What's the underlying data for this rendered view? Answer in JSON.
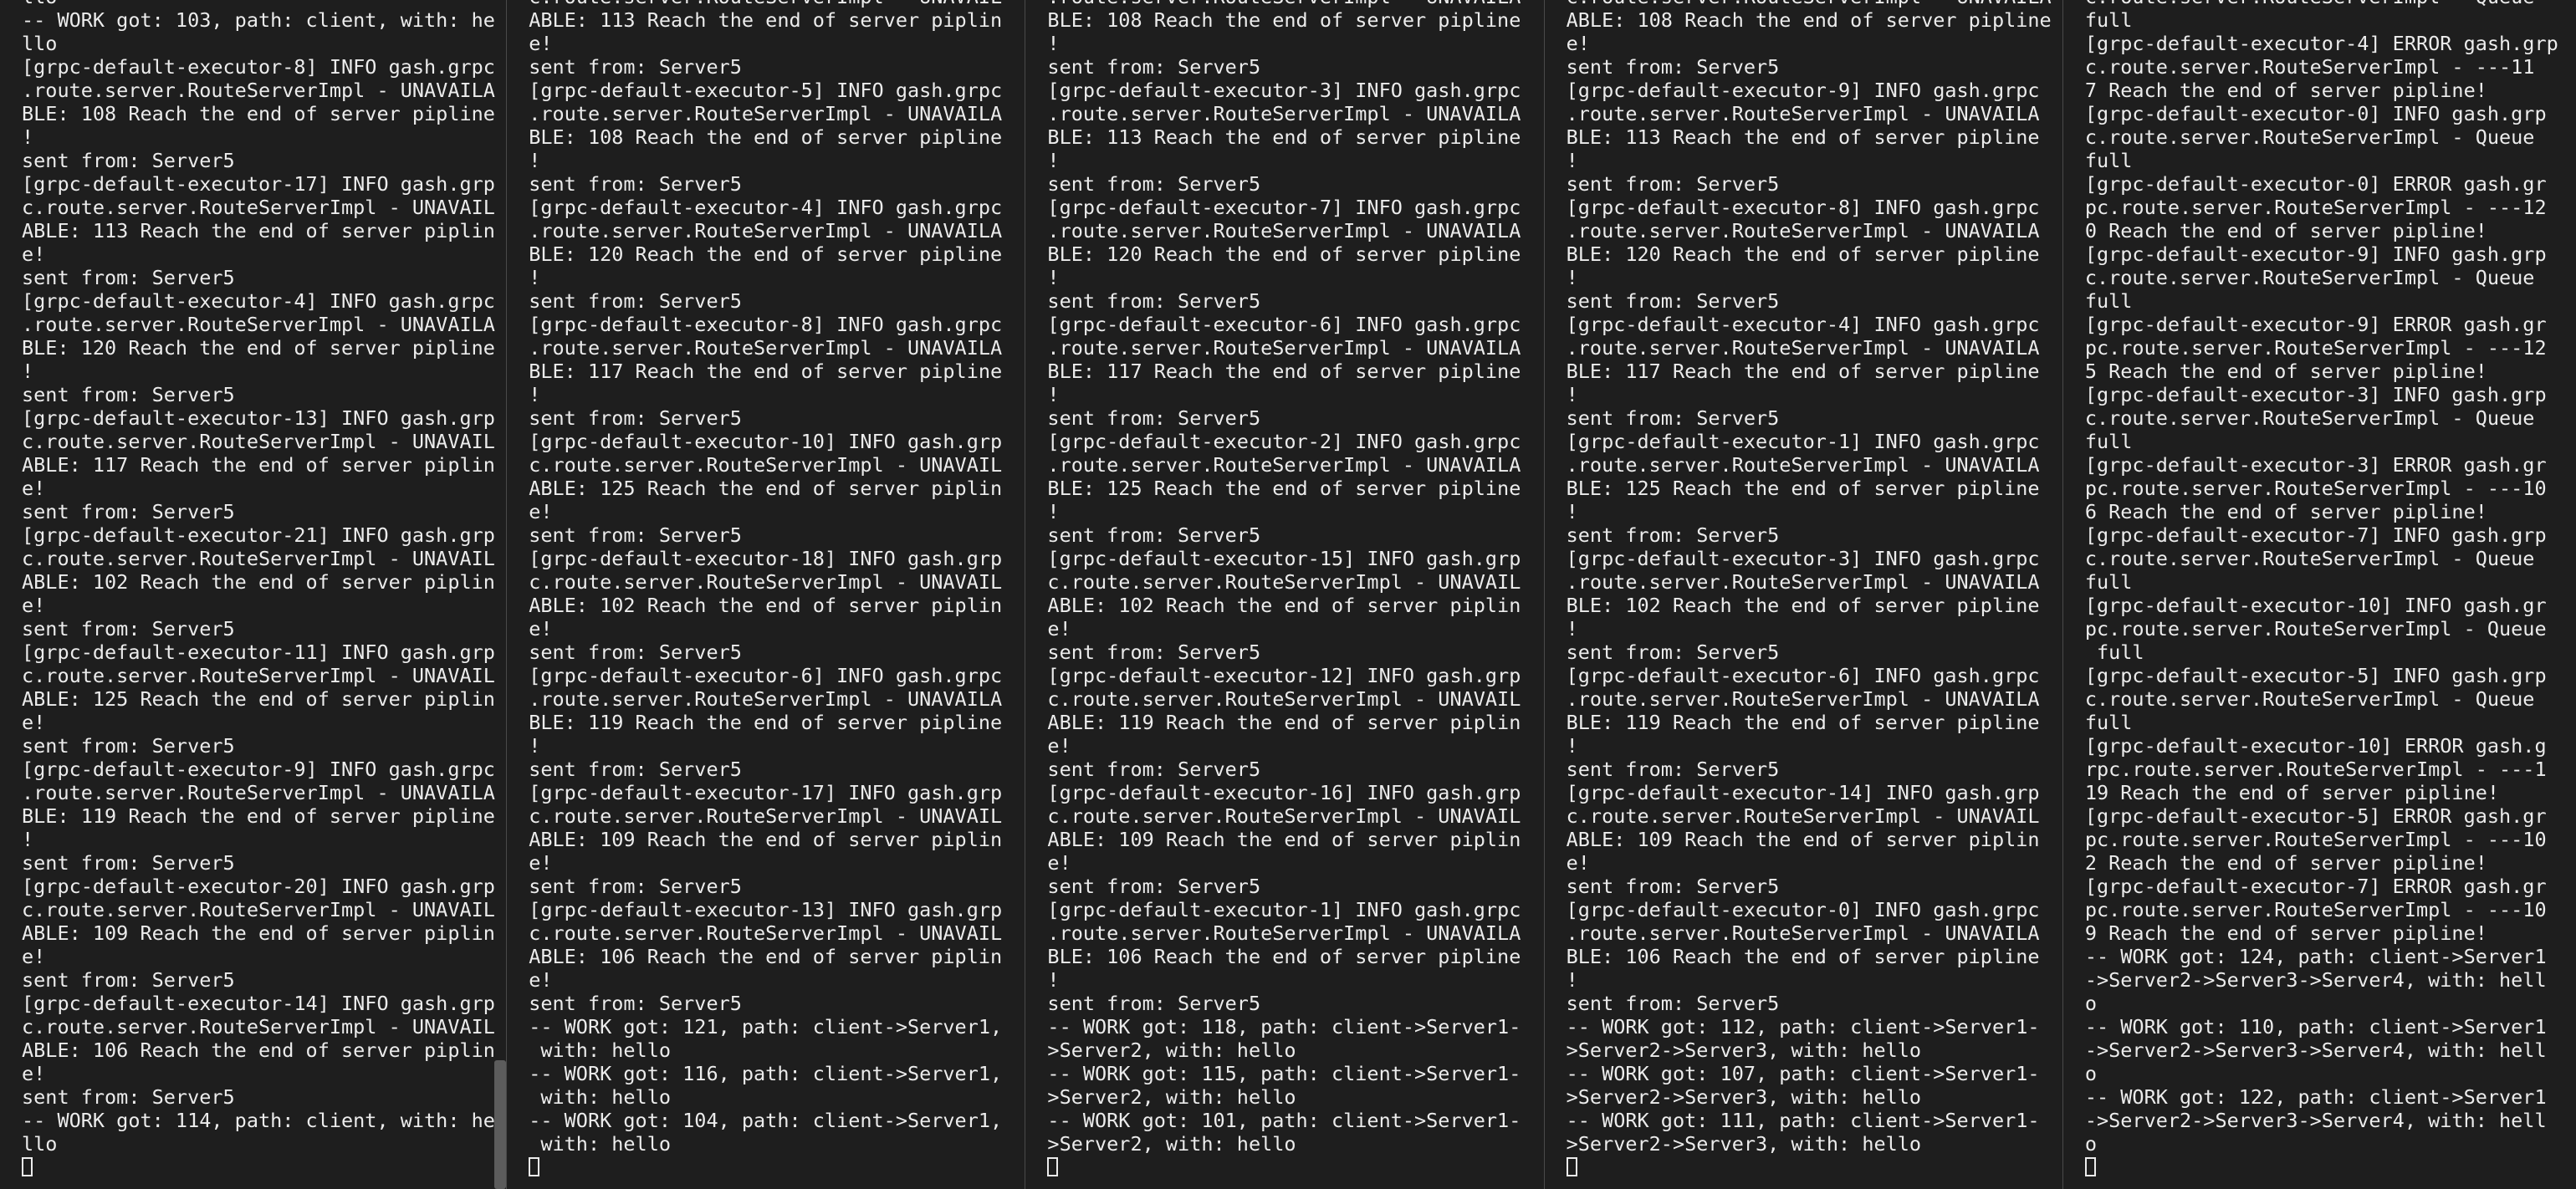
{
  "panes": [
    {
      "lines": [
        "llo",
        "-- WORK got: 103, path: client, with: he",
        "llo",
        "[grpc-default-executor-8] INFO gash.grpc",
        ".route.server.RouteServerImpl - UNAVAILA",
        "BLE: 108 Reach the end of server pipline",
        "!",
        "sent from: Server5",
        "[grpc-default-executor-17] INFO gash.grp",
        "c.route.server.RouteServerImpl - UNAVAIL",
        "ABLE: 113 Reach the end of server piplin",
        "e!",
        "sent from: Server5",
        "[grpc-default-executor-4] INFO gash.grpc",
        ".route.server.RouteServerImpl - UNAVAILA",
        "BLE: 120 Reach the end of server pipline",
        "!",
        "sent from: Server5",
        "[grpc-default-executor-13] INFO gash.grp",
        "c.route.server.RouteServerImpl - UNAVAIL",
        "ABLE: 117 Reach the end of server piplin",
        "e!",
        "sent from: Server5",
        "[grpc-default-executor-21] INFO gash.grp",
        "c.route.server.RouteServerImpl - UNAVAIL",
        "ABLE: 102 Reach the end of server piplin",
        "e!",
        "sent from: Server5",
        "[grpc-default-executor-11] INFO gash.grp",
        "c.route.server.RouteServerImpl - UNAVAIL",
        "ABLE: 125 Reach the end of server piplin",
        "e!",
        "sent from: Server5",
        "[grpc-default-executor-9] INFO gash.grpc",
        ".route.server.RouteServerImpl - UNAVAILA",
        "BLE: 119 Reach the end of server pipline",
        "!",
        "sent from: Server5",
        "[grpc-default-executor-20] INFO gash.grp",
        "c.route.server.RouteServerImpl - UNAVAIL",
        "ABLE: 109 Reach the end of server piplin",
        "e!",
        "sent from: Server5",
        "[grpc-default-executor-14] INFO gash.grp",
        "c.route.server.RouteServerImpl - UNAVAIL",
        "ABLE: 106 Reach the end of server piplin",
        "e!",
        "sent from: Server5",
        "-- WORK got: 114, path: client, with: he",
        "llo"
      ]
    },
    {
      "lines": [
        "c.route.server.RouteServerImpl - UNAVAIL",
        "ABLE: 113 Reach the end of server piplin",
        "e!",
        "sent from: Server5",
        "[grpc-default-executor-5] INFO gash.grpc",
        ".route.server.RouteServerImpl - UNAVAILA",
        "BLE: 108 Reach the end of server pipline",
        "!",
        "sent from: Server5",
        "[grpc-default-executor-4] INFO gash.grpc",
        ".route.server.RouteServerImpl - UNAVAILA",
        "BLE: 120 Reach the end of server pipline",
        "!",
        "sent from: Server5",
        "[grpc-default-executor-8] INFO gash.grpc",
        ".route.server.RouteServerImpl - UNAVAILA",
        "BLE: 117 Reach the end of server pipline",
        "!",
        "sent from: Server5",
        "[grpc-default-executor-10] INFO gash.grp",
        "c.route.server.RouteServerImpl - UNAVAIL",
        "ABLE: 125 Reach the end of server piplin",
        "e!",
        "sent from: Server5",
        "[grpc-default-executor-18] INFO gash.grp",
        "c.route.server.RouteServerImpl - UNAVAIL",
        "ABLE: 102 Reach the end of server piplin",
        "e!",
        "sent from: Server5",
        "[grpc-default-executor-6] INFO gash.grpc",
        ".route.server.RouteServerImpl - UNAVAILA",
        "BLE: 119 Reach the end of server pipline",
        "!",
        "sent from: Server5",
        "[grpc-default-executor-17] INFO gash.grp",
        "c.route.server.RouteServerImpl - UNAVAIL",
        "ABLE: 109 Reach the end of server piplin",
        "e!",
        "sent from: Server5",
        "[grpc-default-executor-13] INFO gash.grp",
        "c.route.server.RouteServerImpl - UNAVAIL",
        "ABLE: 106 Reach the end of server piplin",
        "e!",
        "sent from: Server5",
        "-- WORK got: 121, path: client->Server1,",
        " with: hello",
        "-- WORK got: 116, path: client->Server1,",
        " with: hello",
        "-- WORK got: 104, path: client->Server1,",
        " with: hello"
      ]
    },
    {
      "lines": [
        ".route.server.RouteServerImpl - UNAVAILA",
        "BLE: 108 Reach the end of server pipline",
        "!",
        "sent from: Server5",
        "[grpc-default-executor-3] INFO gash.grpc",
        ".route.server.RouteServerImpl - UNAVAILA",
        "BLE: 113 Reach the end of server pipline",
        "!",
        "sent from: Server5",
        "[grpc-default-executor-7] INFO gash.grpc",
        ".route.server.RouteServerImpl - UNAVAILA",
        "BLE: 120 Reach the end of server pipline",
        "!",
        "sent from: Server5",
        "[grpc-default-executor-6] INFO gash.grpc",
        ".route.server.RouteServerImpl - UNAVAILA",
        "BLE: 117 Reach the end of server pipline",
        "!",
        "sent from: Server5",
        "[grpc-default-executor-2] INFO gash.grpc",
        ".route.server.RouteServerImpl - UNAVAILA",
        "BLE: 125 Reach the end of server pipline",
        "!",
        "sent from: Server5",
        "[grpc-default-executor-15] INFO gash.grp",
        "c.route.server.RouteServerImpl - UNAVAIL",
        "ABLE: 102 Reach the end of server piplin",
        "e!",
        "sent from: Server5",
        "[grpc-default-executor-12] INFO gash.grp",
        "c.route.server.RouteServerImpl - UNAVAIL",
        "ABLE: 119 Reach the end of server piplin",
        "e!",
        "sent from: Server5",
        "[grpc-default-executor-16] INFO gash.grp",
        "c.route.server.RouteServerImpl - UNAVAIL",
        "ABLE: 109 Reach the end of server piplin",
        "e!",
        "sent from: Server5",
        "[grpc-default-executor-1] INFO gash.grpc",
        ".route.server.RouteServerImpl - UNAVAILA",
        "BLE: 106 Reach the end of server pipline",
        "!",
        "sent from: Server5",
        "-- WORK got: 118, path: client->Server1-",
        ">Server2, with: hello",
        "-- WORK got: 115, path: client->Server1-",
        ">Server2, with: hello",
        "-- WORK got: 101, path: client->Server1-",
        ">Server2, with: hello"
      ]
    },
    {
      "lines": [
        "c.route.server.RouteServerImpl - UNAVAILA",
        "ABLE: 108 Reach the end of server pipline",
        "e!",
        "sent from: Server5",
        "[grpc-default-executor-9] INFO gash.grpc",
        ".route.server.RouteServerImpl - UNAVAILA",
        "BLE: 113 Reach the end of server pipline",
        "!",
        "sent from: Server5",
        "[grpc-default-executor-8] INFO gash.grpc",
        ".route.server.RouteServerImpl - UNAVAILA",
        "BLE: 120 Reach the end of server pipline",
        "!",
        "sent from: Server5",
        "[grpc-default-executor-4] INFO gash.grpc",
        ".route.server.RouteServerImpl - UNAVAILA",
        "BLE: 117 Reach the end of server pipline",
        "!",
        "sent from: Server5",
        "[grpc-default-executor-1] INFO gash.grpc",
        ".route.server.RouteServerImpl - UNAVAILA",
        "BLE: 125 Reach the end of server pipline",
        "!",
        "sent from: Server5",
        "[grpc-default-executor-3] INFO gash.grpc",
        ".route.server.RouteServerImpl - UNAVAILA",
        "BLE: 102 Reach the end of server pipline",
        "!",
        "sent from: Server5",
        "[grpc-default-executor-6] INFO gash.grpc",
        ".route.server.RouteServerImpl - UNAVAILA",
        "BLE: 119 Reach the end of server pipline",
        "!",
        "sent from: Server5",
        "[grpc-default-executor-14] INFO gash.grp",
        "c.route.server.RouteServerImpl - UNAVAIL",
        "ABLE: 109 Reach the end of server piplin",
        "e!",
        "sent from: Server5",
        "[grpc-default-executor-0] INFO gash.grpc",
        ".route.server.RouteServerImpl - UNAVAILA",
        "BLE: 106 Reach the end of server pipline",
        "!",
        "sent from: Server5",
        "-- WORK got: 112, path: client->Server1-",
        ">Server2->Server3, with: hello",
        "-- WORK got: 107, path: client->Server1-",
        ">Server2->Server3, with: hello",
        "-- WORK got: 111, path: client->Server1-",
        ">Server2->Server3, with: hello"
      ]
    },
    {
      "lines": [
        "c.route.server.RouteServerImpl - Queue",
        "full",
        "[grpc-default-executor-4] ERROR gash.grp",
        "c.route.server.RouteServerImpl - ---11",
        "7 Reach the end of server pipline!",
        "[grpc-default-executor-0] INFO gash.grp",
        "c.route.server.RouteServerImpl - Queue",
        "full",
        "[grpc-default-executor-0] ERROR gash.gr",
        "pc.route.server.RouteServerImpl - ---12",
        "0 Reach the end of server pipline!",
        "[grpc-default-executor-9] INFO gash.grp",
        "c.route.server.RouteServerImpl - Queue",
        "full",
        "[grpc-default-executor-9] ERROR gash.gr",
        "pc.route.server.RouteServerImpl - ---12",
        "5 Reach the end of server pipline!",
        "[grpc-default-executor-3] INFO gash.grp",
        "c.route.server.RouteServerImpl - Queue",
        "full",
        "[grpc-default-executor-3] ERROR gash.gr",
        "pc.route.server.RouteServerImpl - ---10",
        "6 Reach the end of server pipline!",
        "[grpc-default-executor-7] INFO gash.grp",
        "c.route.server.RouteServerImpl - Queue",
        "full",
        "[grpc-default-executor-10] INFO gash.gr",
        "pc.route.server.RouteServerImpl - Queue",
        " full",
        "[grpc-default-executor-5] INFO gash.grp",
        "c.route.server.RouteServerImpl - Queue",
        "full",
        "[grpc-default-executor-10] ERROR gash.g",
        "rpc.route.server.RouteServerImpl - ---1",
        "19 Reach the end of server pipline!",
        "[grpc-default-executor-5] ERROR gash.gr",
        "pc.route.server.RouteServerImpl - ---10",
        "2 Reach the end of server pipline!",
        "[grpc-default-executor-7] ERROR gash.gr",
        "pc.route.server.RouteServerImpl - ---10",
        "9 Reach the end of server pipline!",
        "-- WORK got: 124, path: client->Server1",
        "->Server2->Server3->Server4, with: hell",
        "o",
        "-- WORK got: 110, path: client->Server1",
        "->Server2->Server3->Server4, with: hell",
        "o",
        "-- WORK got: 122, path: client->Server1",
        "->Server2->Server3->Server4, with: hell",
        "o"
      ]
    }
  ]
}
